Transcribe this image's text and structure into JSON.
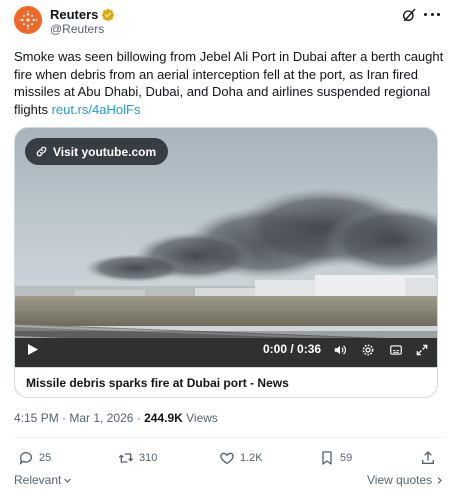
{
  "account": {
    "name": "Reuters",
    "handle": "@Reuters"
  },
  "tweet": {
    "text": "Smoke was seen billowing from Jebel Ali Port in Dubai after a berth caught fire when debris from an aerial interception fell at the port, as Iran fired missiles at Abu Dhabi, Dubai, and Doha and airlines suspended regional flights ",
    "link": "reut.rs/4aHolFs"
  },
  "card": {
    "visit_label": "Visit youtube.com",
    "time": "0:00 / 0:36",
    "title": "Missile debris sparks fire at Dubai port - News"
  },
  "meta": {
    "time": "4:15 PM",
    "sep": " · ",
    "date": "Mar 1, 2026",
    "sep2": " · ",
    "views_count": "244.9K",
    "views_label": " Views"
  },
  "actions": {
    "replies": "25",
    "reposts": "310",
    "likes": "1.2K",
    "bookmarks": "59"
  },
  "footer": {
    "relevant": "Relevant",
    "view_quotes": "View quotes"
  },
  "colors": {
    "accent": "#1d9bf0",
    "brand": "#f26522",
    "verified": "#e2a800"
  }
}
